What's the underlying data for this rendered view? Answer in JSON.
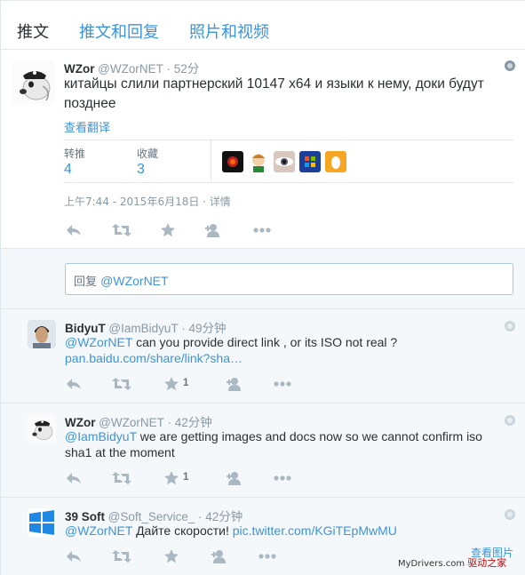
{
  "tabs": [
    {
      "label": "推文"
    },
    {
      "label": "推文和回复"
    },
    {
      "label": "照片和视频"
    }
  ],
  "main_tweet": {
    "fullname": "WZor",
    "screen_name": "@WZorNET",
    "time": "· 52分",
    "text": "китайцы слили партнерский 10147 x64 и языки к нему, доки будут позднее",
    "translate": "查看翻译",
    "retweets_label": "转推",
    "retweets": "4",
    "favorites_label": "收藏",
    "favorites": "3",
    "meta": "上午7:44 - 2015年6月18日 · 详情"
  },
  "reply_box": {
    "prefix": "回复 ",
    "mention": "@WZorNET"
  },
  "replies": [
    {
      "fullname": "BidyuT",
      "screen_name": "@IamBidyuT",
      "time": "· 49分钟",
      "mention": "@WZorNET",
      "text": " can you provide direct link , or its ISO not real ?",
      "link": "pan.baidu.com/share/link?sha…",
      "fav_count": "1"
    },
    {
      "fullname": "WZor",
      "screen_name": "@WZorNET",
      "time": "· 42分钟",
      "mention": "@IamBidyuT",
      "text": "  we are getting images and docs now so we cannot confirm iso sha1 at the moment",
      "fav_count": "1"
    },
    {
      "fullname": "39 Soft",
      "screen_name": "@Soft_Service_",
      "time": "· 42分钟",
      "mention": "@WZorNET",
      "text": " Дайте скорости! ",
      "link": "pic.twitter.com/KGiTEpMwMU"
    }
  ],
  "view_photo": "查看图片",
  "watermark": {
    "site": "MyDrivers.com",
    "cn": "驱动之家"
  },
  "colors": {
    "link": "#3b94d9",
    "muted": "#8899a6",
    "background": "#f5f8fa"
  }
}
